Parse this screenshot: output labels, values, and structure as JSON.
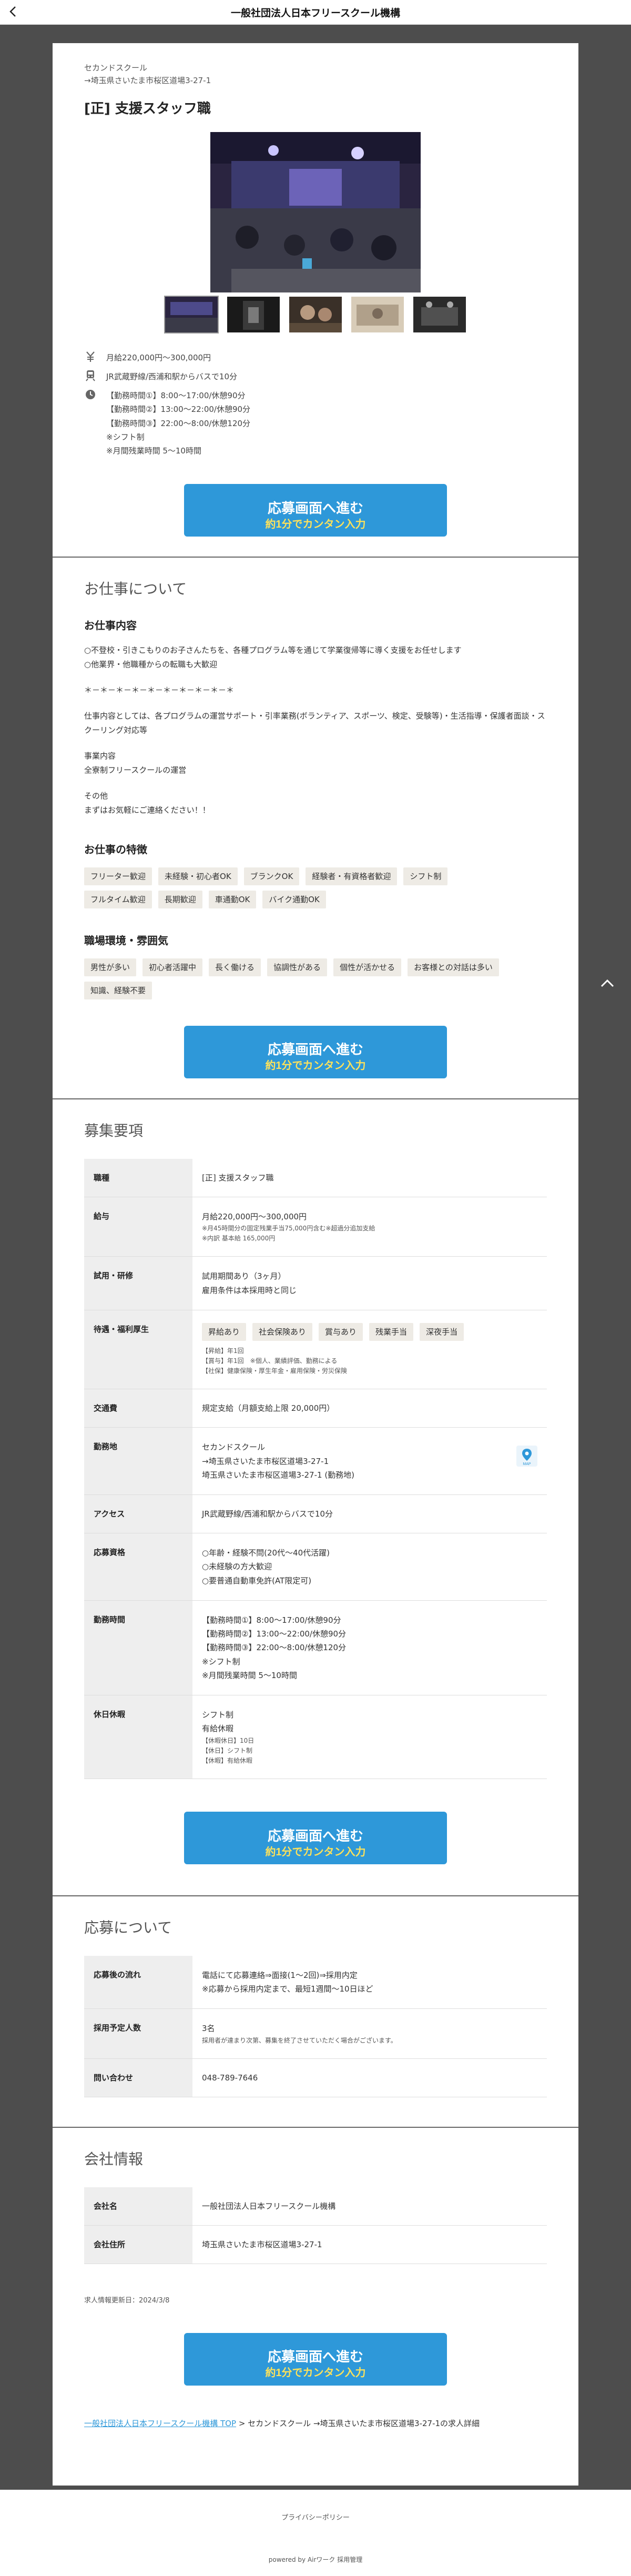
{
  "header": {
    "title": "一般社団法人日本フリースクール機構"
  },
  "job": {
    "school_name": "セカンドスクール",
    "school_address": "→埼玉県さいたま市桜区道場3-27-1",
    "title": "[正] 支援スタッフ職",
    "salary": "月給220,000円〜300,000円",
    "access": "JR武蔵野線/西浦和駅からバスで10分",
    "hours": [
      "【勤務時間①】8:00〜17:00/休憩90分",
      "【勤務時間②】13:00〜22:00/休憩90分",
      "【勤務時間③】22:00〜8:00/休憩120分",
      "※シフト制",
      "※月間残業時間 5〜10時間"
    ]
  },
  "apply_button": {
    "main": "応募画面へ進む",
    "sub": "約1分でカンタン入力"
  },
  "about": {
    "title": "お仕事について",
    "content_title": "お仕事内容",
    "content_lines": [
      "○不登校・引きこもりのお子さんたちを、各種プログラム等を通じて学業復帰等に導く支援をお任せします",
      "○他業界・他職種からの転職も大歓迎",
      "",
      "＊－＊－＊－＊－＊－＊－＊－＊－＊－＊",
      "",
      "仕事内容としては、各プログラムの運営サポート・引率業務(ボランティア、スポーツ、検定、受験等)・生活指導・保護者面談・スクーリング対応等",
      "",
      "事業内容",
      "全寮制フリースクールの運営",
      "",
      "その他",
      "まずはお気軽にご連絡ください！！"
    ],
    "features_title": "お仕事の特徴",
    "features": [
      "フリーター歓迎",
      "未経験・初心者OK",
      "ブランクOK",
      "経験者・有資格者歓迎",
      "シフト制",
      "フルタイム歓迎",
      "長期歓迎",
      "車通勤OK",
      "バイク通勤OK"
    ],
    "environment_title": "職場環境・雰囲気",
    "environment": [
      "男性が多い",
      "初心者活躍中",
      "長く働ける",
      "協調性がある",
      "個性が活かせる",
      "お客様との対話は多い",
      "知識、経験不要"
    ]
  },
  "requirements": {
    "title": "募集要項",
    "job_type_label": "職種",
    "job_type": "[正] 支援スタッフ職",
    "salary_label": "給与",
    "salary": "月給220,000円〜300,000円",
    "salary_notes": [
      "※月45時間分の固定残業手当75,000円含む※超過分追加支給",
      "※内訳 基本給 165,000円"
    ],
    "trial_label": "試用・研修",
    "trial": [
      "試用期間あり（3ヶ月）",
      "雇用条件は本採用時と同じ"
    ],
    "benefits_label": "待遇・福利厚生",
    "benefits_tags": [
      "昇給あり",
      "社会保険あり",
      "賞与あり",
      "残業手当",
      "深夜手当"
    ],
    "benefits_notes": [
      "【昇給】年1回",
      "【賞与】年1回　※個人、業績評価、勤務による",
      "【社保】健康保険・厚生年金・雇用保険・労災保険"
    ],
    "transport_label": "交通費",
    "transport": "規定支給（月額支給上限 20,000円）",
    "location_label": "勤務地",
    "location": [
      "セカンドスクール",
      "→埼玉県さいたま市桜区道場3-27-1",
      "埼玉県さいたま市桜区道場3-27-1 (勤務地)"
    ],
    "map_label": "MAP",
    "access_label": "アクセス",
    "access": "JR武蔵野線/西浦和駅からバスで10分",
    "qualification_label": "応募資格",
    "qualification": [
      "○年齢・経験不問(20代〜40代活躍)",
      "○未経験の方大歓迎",
      "○要普通自動車免許(AT限定可)"
    ],
    "hours_label": "勤務時間",
    "hours": [
      "【勤務時間①】8:00〜17:00/休憩90分",
      "【勤務時間②】13:00〜22:00/休憩90分",
      "【勤務時間③】22:00〜8:00/休憩120分",
      "※シフト制",
      "※月間残業時間 5〜10時間"
    ],
    "holidays_label": "休日休暇",
    "holidays": [
      "シフト制",
      "有給休暇"
    ],
    "holidays_notes": [
      "【休暇休日】10日",
      "【休日】シフト制",
      "【休暇】有給休暇"
    ]
  },
  "application": {
    "title": "応募について",
    "flow_label": "応募後の流れ",
    "flow": [
      "電話にて応募連絡⇒面接(1〜2回)⇒採用内定",
      "※応募から採用内定まで、最短1週間〜10日ほど"
    ],
    "headcount_label": "採用予定人数",
    "headcount": "3名",
    "headcount_note": "採用者が達まり次第、募集を終了させていただく場合がございます。",
    "contact_label": "問い合わせ",
    "contact": "048-789-7646"
  },
  "company": {
    "title": "会社情報",
    "name_label": "会社名",
    "name": "一般社団法人日本フリースクール機構",
    "address_label": "会社住所",
    "address": "埼玉県さいたま市桜区道場3-27-1",
    "updated": "求人情報更新日：2024/3/8"
  },
  "breadcrumb": {
    "top_link": "一般社団法人日本フリースクール機構 TOP",
    "rest": " > セカンドスクール →埼玉県さいたま市桜区道場3-27-1の求人詳細"
  },
  "footer": {
    "privacy": "プライバシーポリシー",
    "powered": "powered by Airワーク 採用管理"
  },
  "colors": {
    "accent": "#2e98d9",
    "accent_sub_text": "#ffe25a",
    "background": "#4d4d4d"
  }
}
